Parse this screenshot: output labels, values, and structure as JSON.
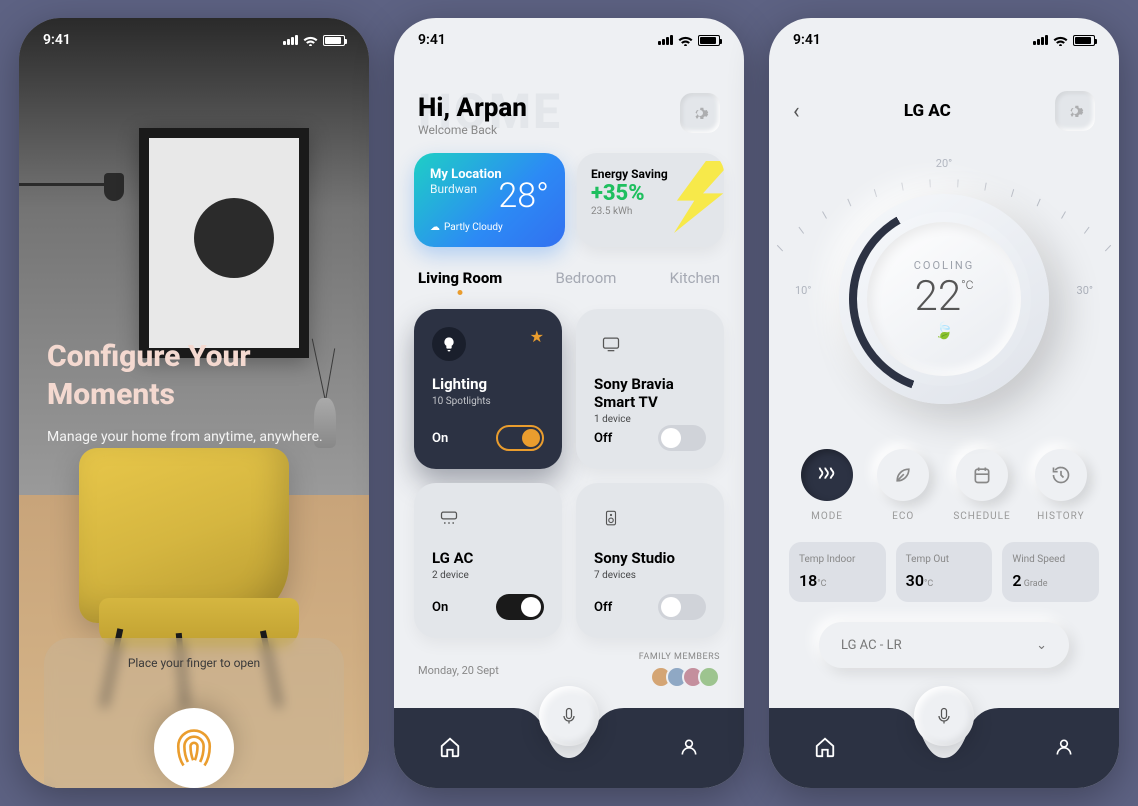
{
  "status_time": "9:41",
  "screen1": {
    "title_l1": "Configure Your",
    "title_l2": "Moments",
    "subtitle": "Manage your home from anytime, anywhere.",
    "hint": "Place your finger to open"
  },
  "screen2": {
    "bg_word": "HOME",
    "greeting": "Hi, Arpan",
    "welcome": "Welcome Back",
    "weather": {
      "title": "My Location",
      "city": "Burdwan",
      "temp": "28°",
      "condition": "Partly Cloudy"
    },
    "energy": {
      "title": "Energy Saving",
      "pct": "+35%",
      "kwh": "23.5 kWh"
    },
    "tabs": [
      "Living Room",
      "Bedroom",
      "Kitchen"
    ],
    "devices": [
      {
        "name": "Lighting",
        "sub": "10 Spotlights",
        "state": "On"
      },
      {
        "name": "Sony Bravia Smart TV",
        "sub": "1 device",
        "state": "Off"
      },
      {
        "name": "LG AC",
        "sub": "2 device",
        "state": "On"
      },
      {
        "name": "Sony Studio",
        "sub": "7 devices",
        "state": "Off"
      }
    ],
    "date": "Monday, 20 Sept",
    "family_label": "FAMILY MEMBERS"
  },
  "screen3": {
    "title": "LG AC",
    "ring": {
      "min": "10°",
      "mid": "20°",
      "max": "30°"
    },
    "mode": "COOLING",
    "temp_value": "22",
    "temp_unit": "°C",
    "buttons": [
      "MODE",
      "ECO",
      "SCHEDULE",
      "HISTORY"
    ],
    "stats": [
      {
        "label": "Temp Indoor",
        "value": "18",
        "unit": "°C"
      },
      {
        "label": "Temp Out",
        "value": "30",
        "unit": "°C"
      },
      {
        "label": "Wind Speed",
        "value": "2",
        "unit": " Grade"
      }
    ],
    "select": "LG AC - LR"
  }
}
